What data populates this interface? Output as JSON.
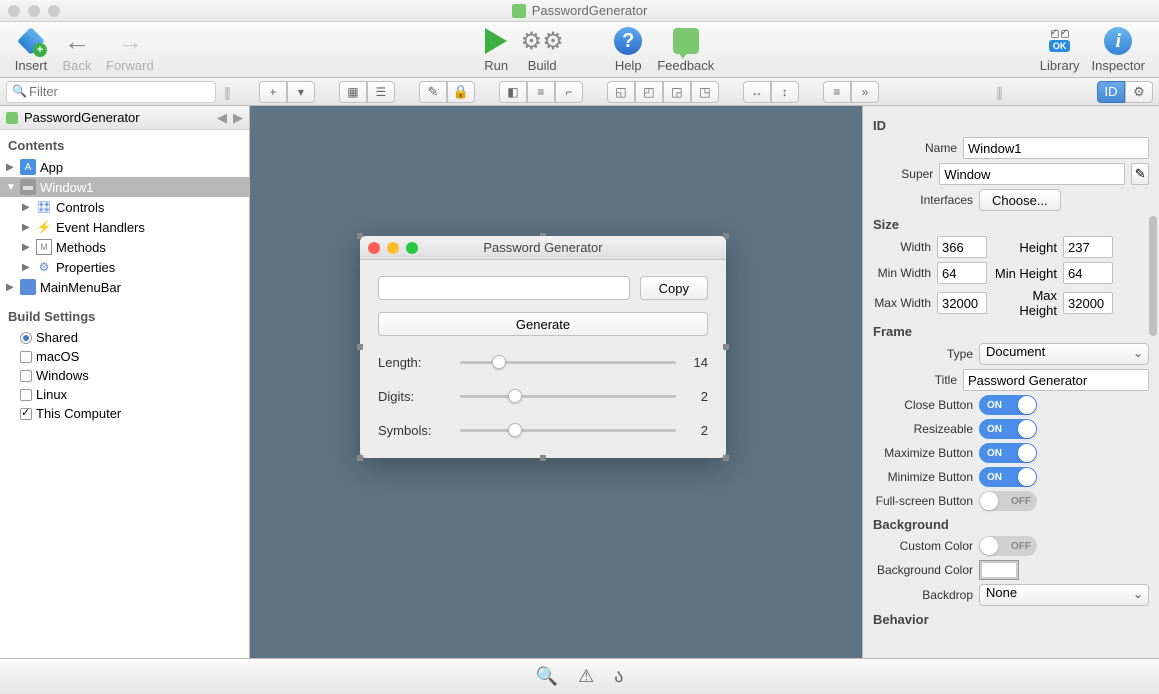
{
  "app": {
    "title": "PasswordGenerator"
  },
  "toolbar": {
    "insert": "Insert",
    "back": "Back",
    "forward": "Forward",
    "run": "Run",
    "build": "Build",
    "help": "Help",
    "feedback": "Feedback",
    "library": "Library",
    "inspector": "Inspector",
    "lib_ok": "OK"
  },
  "search": {
    "placeholder": "Filter"
  },
  "breadcrumb": {
    "project": "PasswordGenerator"
  },
  "nav": {
    "contents_header": "Contents",
    "app": "App",
    "window1": "Window1",
    "controls": "Controls",
    "events": "Event Handlers",
    "methods": "Methods",
    "properties": "Properties",
    "mainmenu": "MainMenuBar",
    "build_header": "Build Settings",
    "shared": "Shared",
    "macos": "macOS",
    "windows": "Windows",
    "linux": "Linux",
    "thiscomp": "This Computer"
  },
  "designer": {
    "title": "Password Generator",
    "copy": "Copy",
    "generate": "Generate",
    "length_label": "Length:",
    "length_val": "14",
    "digits_label": "Digits:",
    "digits_val": "2",
    "symbols_label": "Symbols:",
    "symbols_val": "2"
  },
  "inspector": {
    "id_header": "ID",
    "name_label": "Name",
    "name_val": "Window1",
    "super_label": "Super",
    "super_val": "Window",
    "interfaces_label": "Interfaces",
    "interfaces_btn": "Choose...",
    "size_header": "Size",
    "width_label": "Width",
    "width_val": "366",
    "height_label": "Height",
    "height_val": "237",
    "minw_label": "Min Width",
    "minw_val": "64",
    "minh_label": "Min Height",
    "minh_val": "64",
    "maxw_label": "Max Width",
    "maxw_val": "32000",
    "maxh_label": "Max Height",
    "maxh_val": "32000",
    "frame_header": "Frame",
    "type_label": "Type",
    "type_val": "Document",
    "title_label": "Title",
    "title_val": "Password Generator",
    "close_label": "Close Button",
    "resize_label": "Resizeable",
    "max_label": "Maximize Button",
    "min_label": "Minimize Button",
    "full_label": "Full-screen Button",
    "bg_header": "Background",
    "custom_label": "Custom Color",
    "bgcolor_label": "Background Color",
    "backdrop_label": "Backdrop",
    "backdrop_val": "None",
    "behavior_header": "Behavior",
    "on": "ON",
    "off": "OFF"
  }
}
